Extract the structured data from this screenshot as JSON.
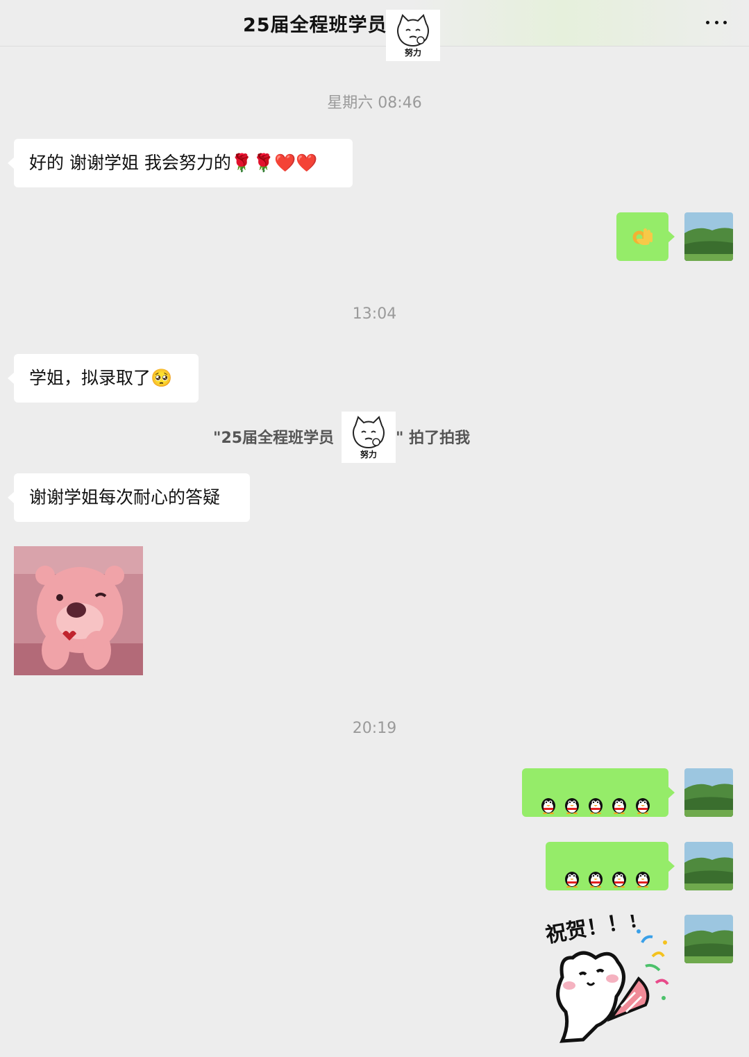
{
  "header": {
    "title": "25届全程班学员",
    "sticker_caption": "努力",
    "more_icon": "more-dots-icon"
  },
  "messages": {
    "time1": "星期六 08:46",
    "msg1": "好的 谢谢学姐 我会努力的🌹🌹❤️❤️",
    "time2": "13:04",
    "msg2": "学姐，拟录取了🥺",
    "pat_prefix": "\"25届全程班学员",
    "pat_suffix": "\" 拍了拍我",
    "pat_sticker_caption": "努力",
    "msg3": "谢谢学姐每次耐心的答疑",
    "time3": "20:19",
    "sticker_text": "祝贺！！！"
  },
  "colors": {
    "background": "#ededed",
    "bubble_self": "#95ec69",
    "bubble_other": "#ffffff",
    "time_text": "#9a9a9a"
  },
  "icons": {
    "ok_hand": "ok-hand-emoji",
    "penguin": "penguin-emoji"
  }
}
